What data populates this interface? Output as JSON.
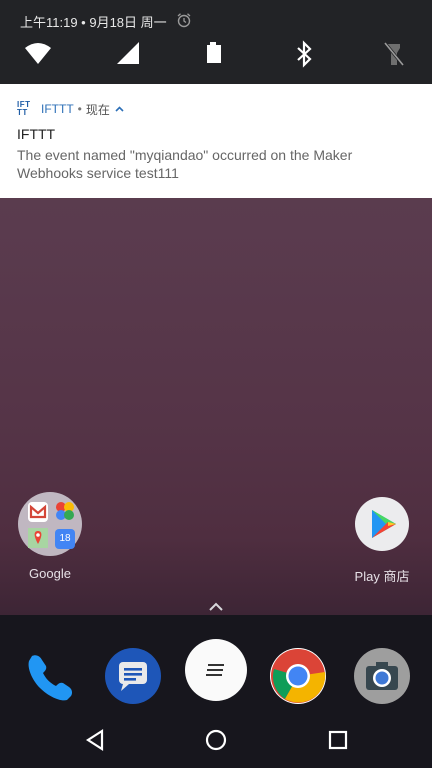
{
  "status_bar": {
    "datetime": "上午11:19 • 9月18日 周一"
  },
  "quick_settings": {
    "icons": [
      "wifi-icon",
      "signal-icon",
      "battery-icon",
      "bluetooth-icon",
      "flashlight-off-icon"
    ]
  },
  "notification": {
    "app_logo_line1": "IFT",
    "app_logo_line2": "TT",
    "app_name": "IFTTT",
    "separator": "•",
    "time": "现在",
    "title": "IFTTT",
    "body": "The event named \"myqiandao\" occurred on the Maker Webhooks service test111"
  },
  "home": {
    "folder_label": "Google",
    "play_label": "Play 商店"
  },
  "dock": {
    "apps": [
      "phone-icon",
      "messages-icon",
      "app-drawer-icon",
      "chrome-icon",
      "camera-icon"
    ]
  },
  "nav_bar": {
    "buttons": [
      "back-icon",
      "home-icon",
      "recents-icon"
    ]
  },
  "colors": {
    "shade_bg": "#222326",
    "accent": "#2c6fb7"
  }
}
